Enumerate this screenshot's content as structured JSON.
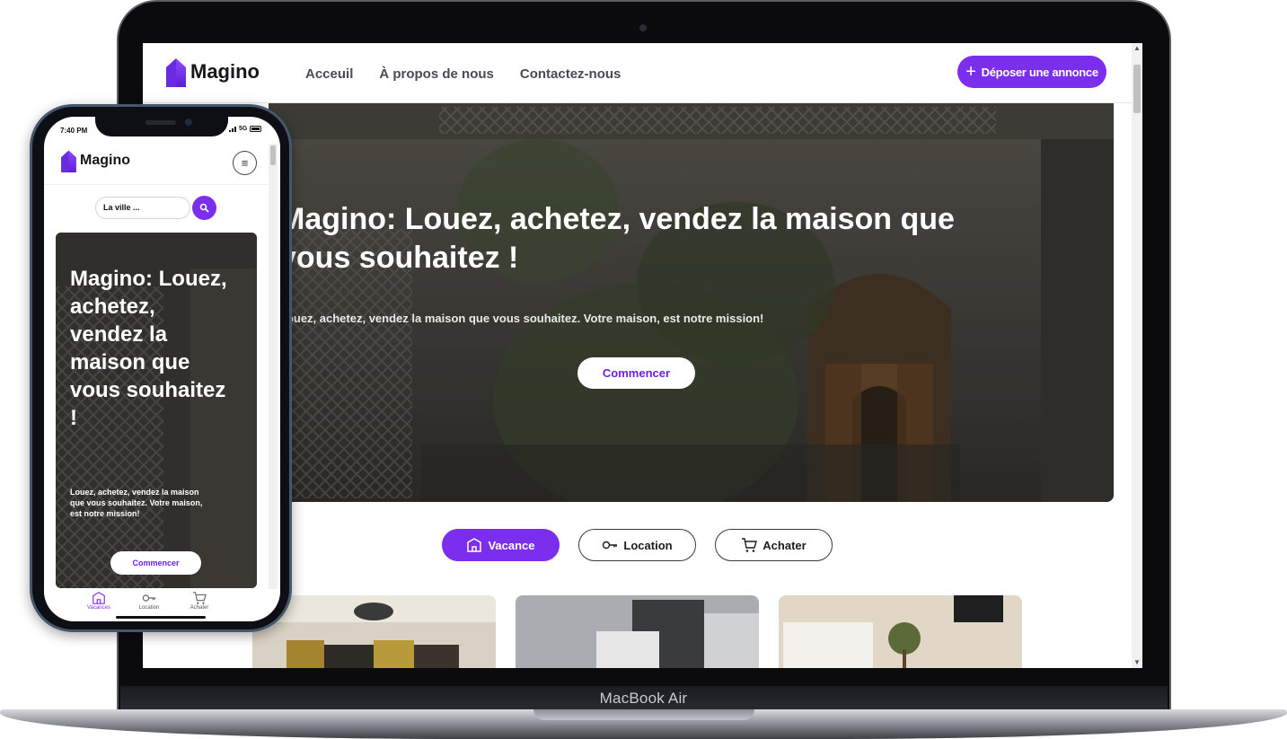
{
  "device_labels": {
    "laptop_brand": "MacBook Air"
  },
  "colors": {
    "accent": "#7b2fed",
    "dark_text": "#16161a"
  },
  "desktop": {
    "brand": "Magino",
    "nav": [
      "Acceuil",
      "À propos de nous",
      "Contactez-nous"
    ],
    "post_button": "Déposer une annonce",
    "hero": {
      "title": "Magino: Louez, achetez, vendez la maison que vous souhaitez !",
      "subtitle": "Louez, achetez, vendez la maison que vous souhaitez. Votre maison, est notre mission!",
      "cta": "Commencer"
    },
    "tabs": [
      {
        "label": "Vacance",
        "icon": "house-icon",
        "active": true
      },
      {
        "label": "Location",
        "icon": "key-icon",
        "active": false
      },
      {
        "label": "Achater",
        "icon": "cart-icon",
        "active": false
      }
    ]
  },
  "mobile": {
    "status_time": "7:40 PM",
    "network": "5G",
    "brand": "Magino",
    "search_placeholder": "La ville ...",
    "hero": {
      "title": "Magino: Louez, achetez, vendez la maison que vous souhaitez !",
      "subtitle": "Louez, achetez, vendez la maison que vous souhaitez. Votre maison, est notre mission!",
      "cta": "Commencer"
    },
    "tabbar": [
      {
        "label": "Vacances",
        "active": true
      },
      {
        "label": "Location",
        "active": false
      },
      {
        "label": "Achater",
        "active": false
      }
    ]
  }
}
